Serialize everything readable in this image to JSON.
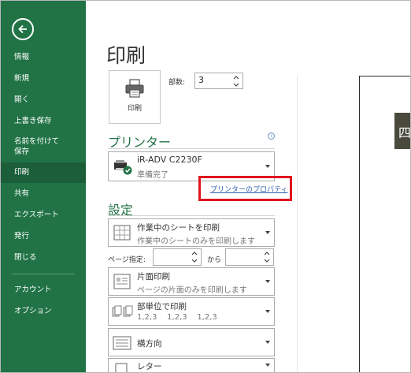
{
  "sidebar": {
    "items": [
      {
        "label": "情報"
      },
      {
        "label": "新規"
      },
      {
        "label": "開く"
      },
      {
        "label": "上書き保存"
      },
      {
        "label": "名前を付けて",
        "label2": "保存"
      },
      {
        "label": "印刷"
      },
      {
        "label": "共有"
      },
      {
        "label": "エクスポート"
      },
      {
        "label": "発行"
      },
      {
        "label": "閉じる"
      },
      {
        "label": "アカウント"
      },
      {
        "label": "オプション"
      }
    ],
    "active_item": "印刷",
    "colors": {
      "background": "#217346",
      "active": "#1b5e39"
    }
  },
  "main": {
    "title": "印刷",
    "print_button_label": "印刷",
    "copies_label": "部数:",
    "copies_value": "3",
    "printer_section": {
      "title": "プリンター",
      "printer_name": "iR-ADV C2230F",
      "printer_status": "準備完了",
      "properties_link": "プリンターのプロパティ"
    },
    "settings_section": {
      "title": "設定",
      "scope": {
        "title": "作業中のシートを印刷",
        "desc": "作業中のシートのみを印刷します"
      },
      "page_range_label": "ページ指定:",
      "page_range_to": "から",
      "sides": {
        "title": "片面印刷",
        "desc": "ページの片面のみを印刷します"
      },
      "collate": {
        "title": "部単位で印刷",
        "desc": "1,2,3    1,2,3    1,2,3"
      },
      "orientation": {
        "title": "横方向"
      },
      "paper": {
        "title": "レター"
      }
    }
  },
  "preview": {
    "visible_char": "四"
  },
  "accent_colors": {
    "green": "#217346",
    "link": "#2f5fad",
    "highlight": "#e0141e"
  }
}
